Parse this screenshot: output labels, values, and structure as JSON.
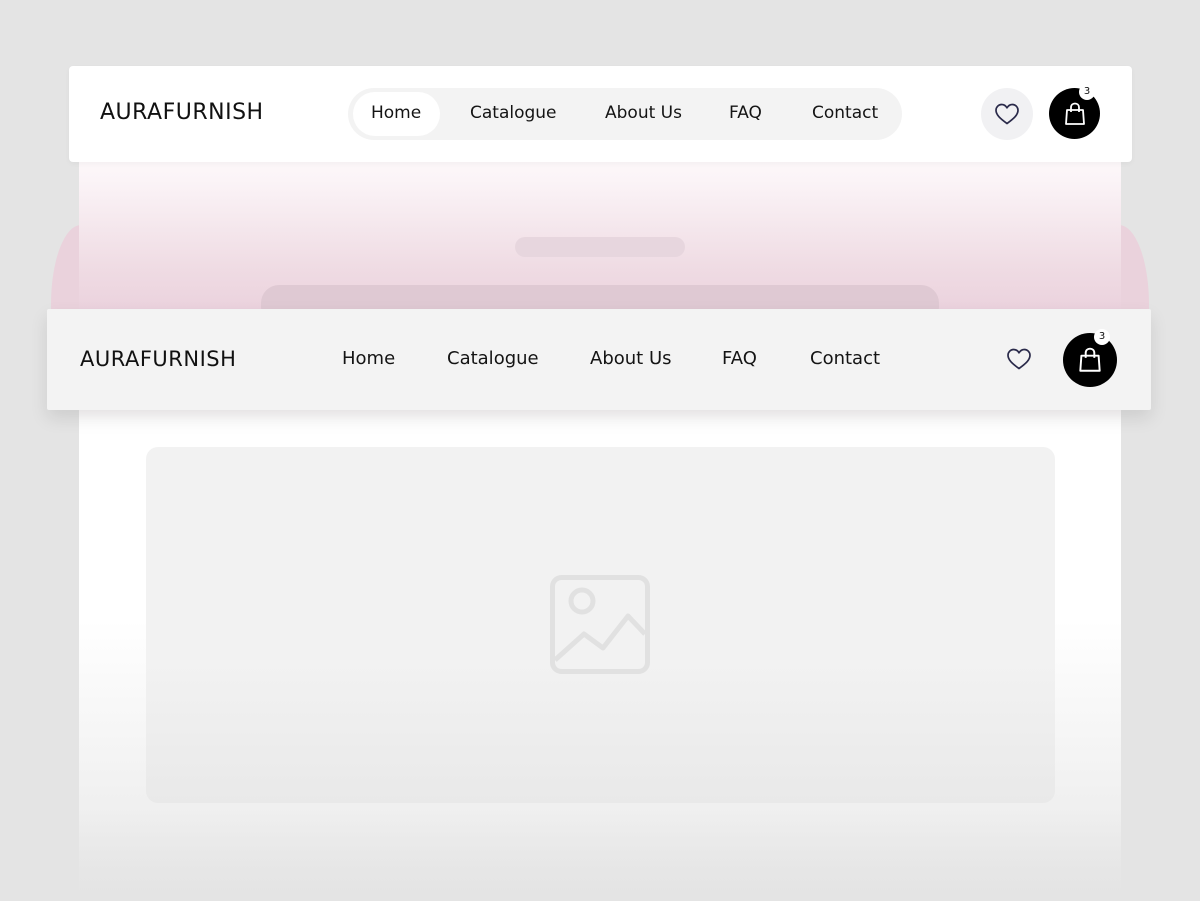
{
  "brand": "AURAFURNISH",
  "nav_top": {
    "links": [
      "Home",
      "Catalogue",
      "About Us",
      "FAQ",
      "Contact"
    ],
    "active": "Home",
    "cart_count": "3"
  },
  "nav_second": {
    "links": [
      "Home",
      "Catalogue",
      "About Us",
      "FAQ",
      "Contact"
    ],
    "cart_count": "3"
  },
  "icons": {
    "wishlist": "heart-icon",
    "cart": "shopping-bag-icon",
    "placeholder": "image-icon"
  },
  "colors": {
    "background": "#e4e4e4",
    "accent_pink": "#ead0dc",
    "cart_button": "#000000",
    "heart_stroke": "#2a2a4a"
  }
}
